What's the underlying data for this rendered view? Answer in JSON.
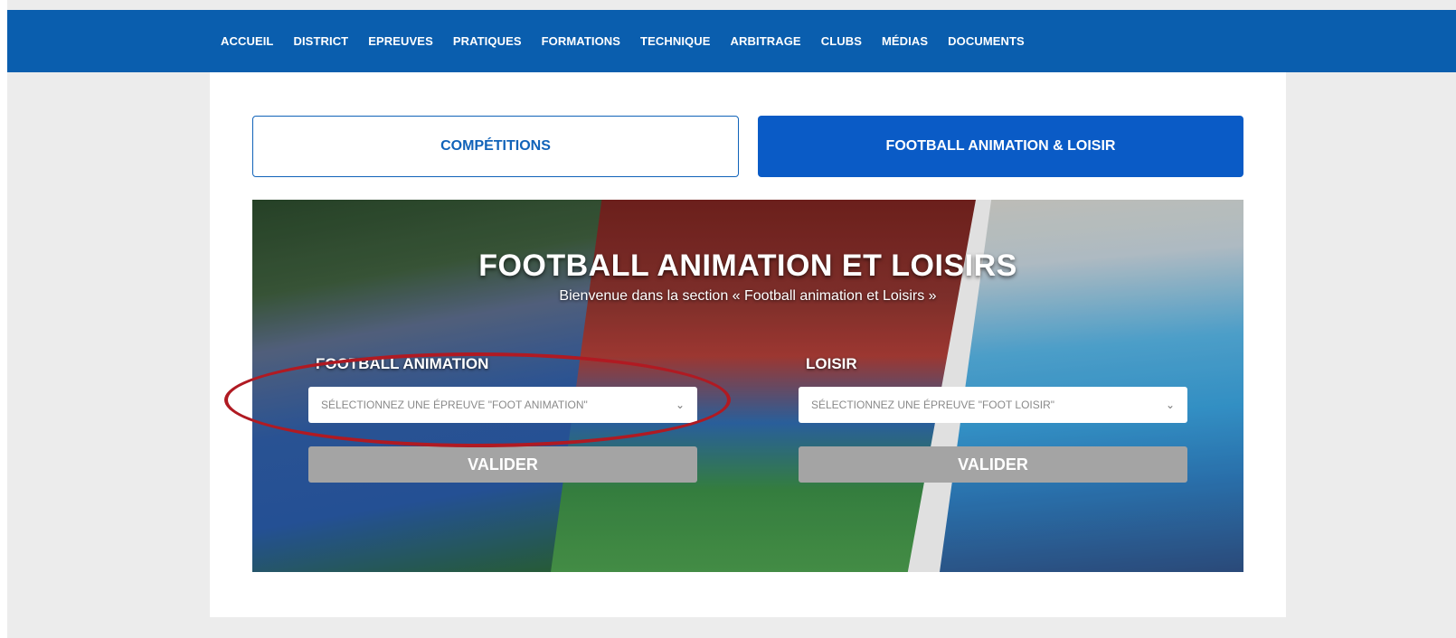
{
  "nav": {
    "items": [
      {
        "label": "ACCUEIL"
      },
      {
        "label": "DISTRICT"
      },
      {
        "label": "EPREUVES"
      },
      {
        "label": "PRATIQUES"
      },
      {
        "label": "FORMATIONS"
      },
      {
        "label": "TECHNIQUE"
      },
      {
        "label": "ARBITRAGE"
      },
      {
        "label": "CLUBS"
      },
      {
        "label": "MÉDIAS"
      },
      {
        "label": "DOCUMENTS"
      }
    ]
  },
  "tabs": {
    "competitions": "COMPÉTITIONS",
    "animation": "FOOTBALL ANIMATION & LOISIR"
  },
  "hero": {
    "title": "FOOTBALL ANIMATION ET LOISIRS",
    "subtitle": "Bienvenue dans la section « Football animation et Loisirs »"
  },
  "animation": {
    "label": "FOOTBALL ANIMATION",
    "select_value": "SÉLECTIONNEZ UNE ÉPREUVE \"FOOT ANIMATION\"",
    "button": "VALIDER"
  },
  "loisir": {
    "label": "LOISIR",
    "select_value": "SÉLECTIONNEZ UNE ÉPREUVE \"FOOT LOISIR\"",
    "button": "VALIDER"
  },
  "colors": {
    "nav_bg": "#0a5eae",
    "accent": "#0a5bc6",
    "annotation": "#b01a22"
  }
}
